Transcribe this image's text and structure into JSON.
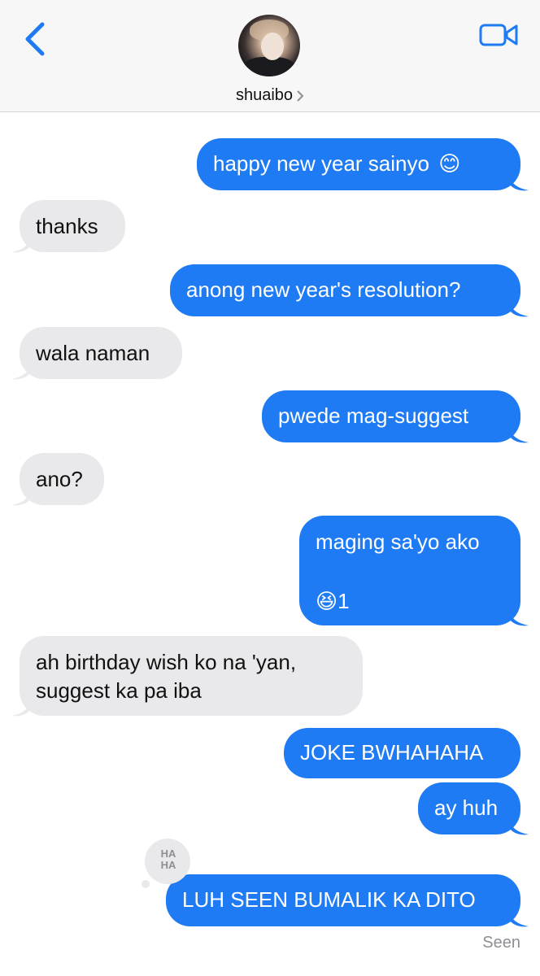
{
  "header": {
    "contact_name": "shuaibo",
    "back_icon": "chevron-left-icon",
    "video_icon": "video-camera-icon"
  },
  "colors": {
    "outgoing_bubble": "#1e7bf3",
    "incoming_bubble": "#e9e9eb",
    "accent": "#1e7bf3"
  },
  "messages": [
    {
      "direction": "outgoing",
      "text": "happy new year sainyo",
      "emoji": "😊"
    },
    {
      "direction": "incoming",
      "text": "thanks"
    },
    {
      "direction": "outgoing",
      "text": "anong new year's resolution?"
    },
    {
      "direction": "incoming",
      "text": "wala naman"
    },
    {
      "direction": "outgoing",
      "text": "pwede mag-suggest"
    },
    {
      "direction": "incoming",
      "text": "ano?"
    },
    {
      "direction": "outgoing",
      "line1": "maging sa'yo ako",
      "line2_emoji": "😆",
      "line2_text": "1"
    },
    {
      "direction": "incoming",
      "line1": "ah birthday wish ko na 'yan,",
      "line2": "suggest ka pa iba"
    },
    {
      "direction": "outgoing",
      "text": "JOKE BWHAHAHA"
    },
    {
      "direction": "outgoing",
      "text": "ay huh"
    },
    {
      "direction": "outgoing",
      "text": "LUH SEEN BUMALIK KA DITO",
      "reaction": "HA HA"
    }
  ],
  "reaction_badge": {
    "line1": "HA",
    "line2": "HA",
    "icon": "haha-reaction-icon"
  },
  "status": {
    "seen": "Seen"
  }
}
